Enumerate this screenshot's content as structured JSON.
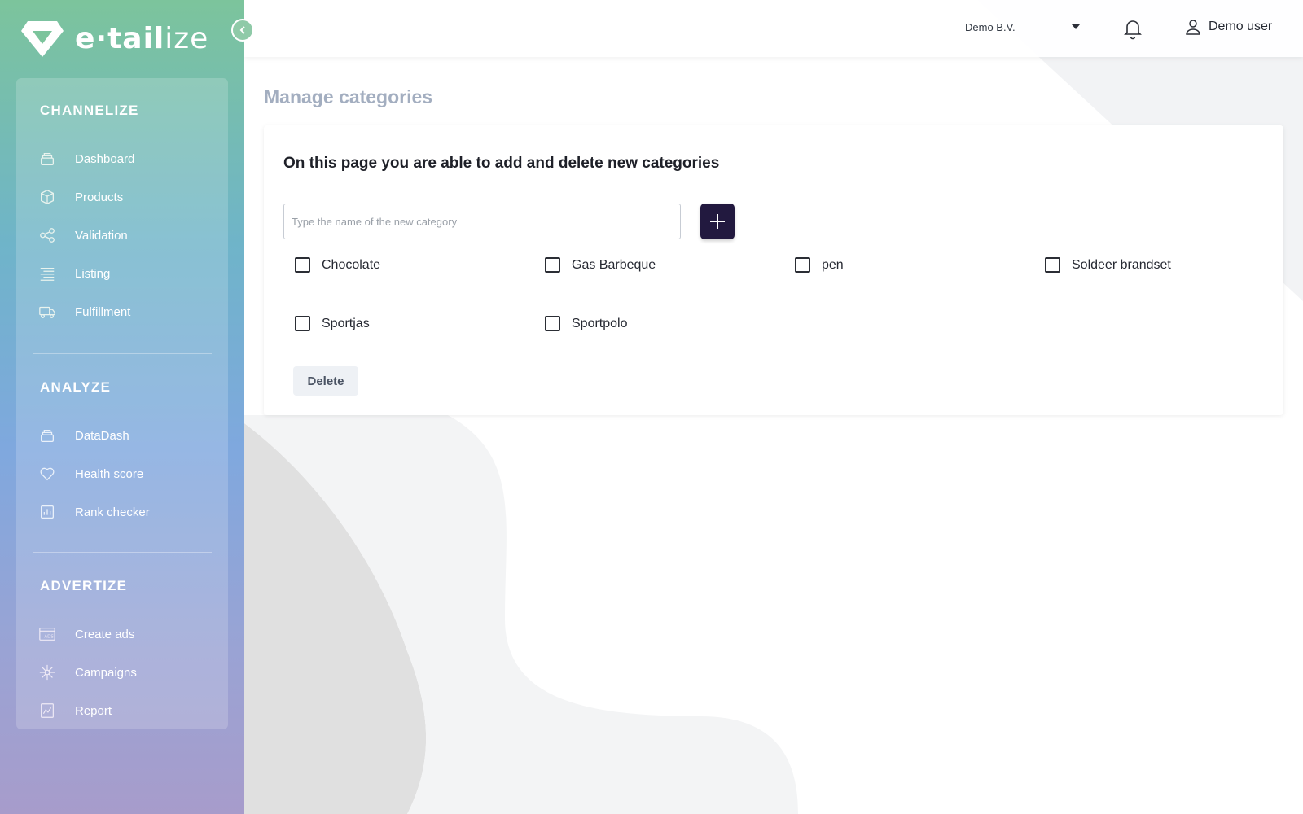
{
  "app": {
    "logo_text_bold": "e·tail",
    "logo_text_light": "ize"
  },
  "sidebar": {
    "sections": [
      {
        "title": "CHANNELIZE",
        "items": [
          {
            "label": "Dashboard",
            "icon": "layers-icon"
          },
          {
            "label": "Products",
            "icon": "box-icon"
          },
          {
            "label": "Validation",
            "icon": "share-nodes-icon"
          },
          {
            "label": "Listing",
            "icon": "list-lines-icon"
          },
          {
            "label": "Fulfillment",
            "icon": "truck-icon"
          }
        ]
      },
      {
        "title": "ANALYZE",
        "items": [
          {
            "label": "DataDash",
            "icon": "layers-icon"
          },
          {
            "label": "Health score",
            "icon": "heart-icon"
          },
          {
            "label": "Rank checker",
            "icon": "bar-chart-icon"
          }
        ]
      },
      {
        "title": "ADVERTIZE",
        "items": [
          {
            "label": "Create ads",
            "icon": "ads-icon"
          },
          {
            "label": "Campaigns",
            "icon": "network-icon"
          },
          {
            "label": "Report",
            "icon": "line-chart-icon"
          }
        ]
      }
    ]
  },
  "topbar": {
    "company": "Demo B.V.",
    "user_name": "Demo user"
  },
  "page": {
    "title": "Manage categories",
    "heading": "On this page you are able to add and delete new categories",
    "input_placeholder": "Type the name of the new category",
    "input_value": "",
    "delete_label": "Delete",
    "categories": [
      {
        "label": "Chocolate",
        "checked": false
      },
      {
        "label": "Gas Barbeque",
        "checked": false
      },
      {
        "label": "pen",
        "checked": false
      },
      {
        "label": "Soldeer brandset",
        "checked": false
      },
      {
        "label": "Sportjas",
        "checked": false
      },
      {
        "label": "Sportpolo",
        "checked": false
      }
    ]
  },
  "colors": {
    "add_button": "#22193f",
    "page_title": "#a3aec0",
    "sidebar_top": "#7cc49c",
    "sidebar_bottom": "#a79ccb"
  }
}
